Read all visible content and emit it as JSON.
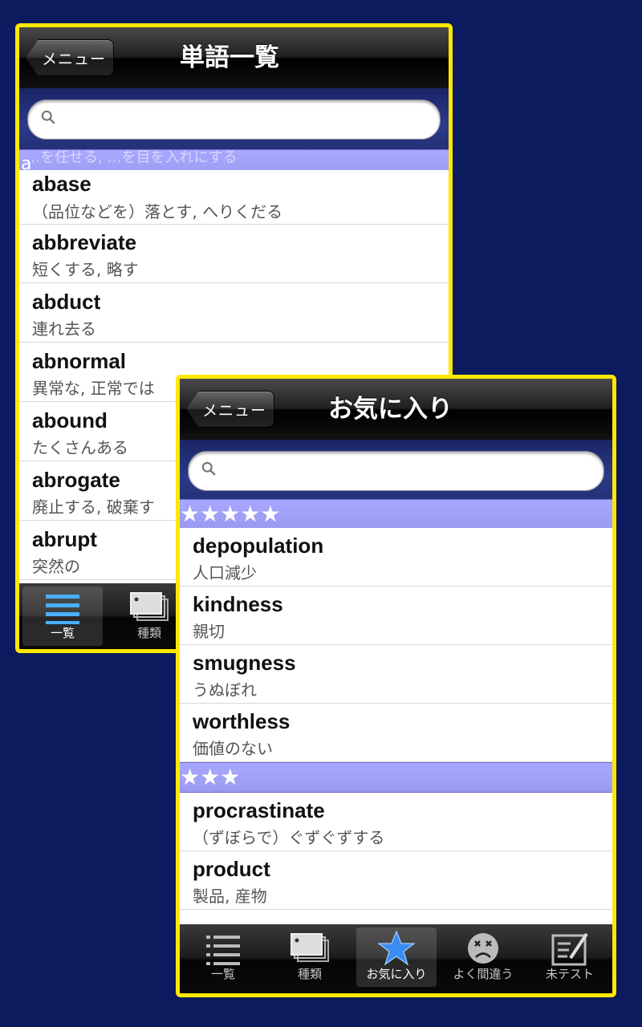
{
  "phone_a": {
    "back_label": "メニュー",
    "title": "単語一覧",
    "search_placeholder": "",
    "ghost_text": "…を任せる, …を目を入れにする",
    "section": "a",
    "rows": [
      {
        "word": "abase",
        "meaning": "（品位などを）落とす, へりくだる"
      },
      {
        "word": "abbreviate",
        "meaning": "短くする, 略す"
      },
      {
        "word": "abduct",
        "meaning": "連れ去る"
      },
      {
        "word": "abnormal",
        "meaning": "異常な, 正常では"
      },
      {
        "word": "abound",
        "meaning": "たくさんある"
      },
      {
        "word": "abrogate",
        "meaning": "廃止する, 破棄す"
      },
      {
        "word": "abrupt",
        "meaning": "突然の"
      }
    ],
    "tabs": [
      {
        "label": "一覧",
        "icon": "list-icon",
        "active": true
      },
      {
        "label": "種類",
        "icon": "cards-icon",
        "active": false
      }
    ]
  },
  "phone_b": {
    "back_label": "メニュー",
    "title": "お気に入り",
    "search_placeholder": "",
    "sections": [
      {
        "label": "★★★★★",
        "rows": [
          {
            "word": "depopulation",
            "meaning": "人口減少"
          },
          {
            "word": "kindness",
            "meaning": "親切"
          },
          {
            "word": "smugness",
            "meaning": "うぬぼれ"
          },
          {
            "word": "worthless",
            "meaning": "価値のない"
          }
        ]
      },
      {
        "label": "★★★",
        "rows": [
          {
            "word": "procrastinate",
            "meaning": "（ずぼらで）ぐずぐずする"
          },
          {
            "word": "product",
            "meaning": "製品, 産物"
          }
        ]
      }
    ],
    "tabs": [
      {
        "label": "一覧",
        "icon": "list-icon",
        "active": false
      },
      {
        "label": "種類",
        "icon": "cards-icon",
        "active": false
      },
      {
        "label": "お気に入り",
        "icon": "star-icon",
        "active": true
      },
      {
        "label": "よく間違う",
        "icon": "sad-face-icon",
        "active": false
      },
      {
        "label": "未テスト",
        "icon": "edit-note-icon",
        "active": false
      }
    ]
  },
  "colors": {
    "background": "#0c1a5e",
    "frame": "#ffe800",
    "section_header": "#a8a8ff",
    "active_star": "#3a8cf0"
  }
}
